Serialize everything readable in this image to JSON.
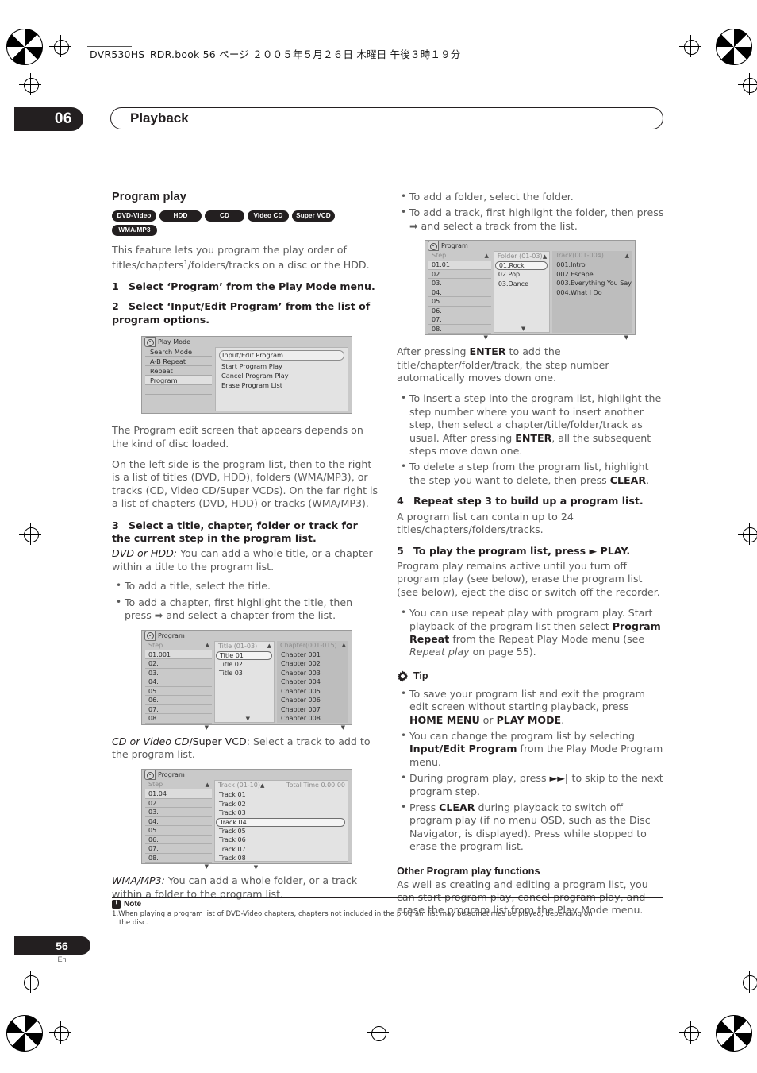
{
  "print_header": "DVR530HS_RDR.book  56 ページ  ２００５年５月２６日   木曜日   午後３時１９分",
  "chapter": {
    "number": "06",
    "title": "Playback"
  },
  "folio": {
    "page": "56",
    "lang": "En"
  },
  "left": {
    "section_title": "Program play",
    "badges": [
      "DVD-Video",
      "HDD",
      "CD",
      "Video CD",
      "Super VCD",
      "WMA/MP3"
    ],
    "intro": "This feature lets you program the play order of titles/chapters",
    "intro_sup": "1",
    "intro_rest": "/folders/tracks on a disc or the HDD.",
    "step1_num": "1",
    "step1": "Select ‘Program’ from the Play Mode menu.",
    "step2_num": "2",
    "step2": "Select ‘Input/Edit Program’ from the list of program options.",
    "play_mode_osd": {
      "title": "Play Mode",
      "menu": [
        "Search Mode",
        "A-B Repeat",
        "Repeat",
        "Program"
      ],
      "selected_menu": "Program",
      "options": [
        "Input/Edit Program",
        "Start Program Play",
        "Cancel Program Play",
        "Erase Program List"
      ],
      "highlighted_option": "Input/Edit Program"
    },
    "para_depends": "The Program edit screen that appears depends on the kind of disc loaded.",
    "para_layout": "On the left side is the program list, then to the right is a list of titles (DVD, HDD), folders (WMA/MP3), or tracks (CD, Video CD/Super VCDs). On the far right is a list of chapters (DVD, HDD) or tracks (WMA/MP3).",
    "step3_num": "3",
    "step3": "Select a title, chapter, folder or track for the current step in the program list.",
    "dvd_hdd_label": "DVD or HDD:",
    "dvd_hdd_text": " You can add a whole title, or a chapter within a title to the program list.",
    "bullets_dvd": [
      "To add a title, select the title.",
      "To add a chapter, first highlight the title, then press ➡ and select a chapter from the list."
    ],
    "program_osd_dvd": {
      "title": "Program",
      "col1_head": "Step",
      "col2_head": "Title (01-03)",
      "col3_head": "Chapter(001-015)",
      "steps": [
        "01.001",
        "02.",
        "03.",
        "04.",
        "05.",
        "06.",
        "07.",
        "08."
      ],
      "titles": [
        "Title 01",
        "Title 02",
        "Title 03"
      ],
      "highlighted_title": "Title 01",
      "chapters": [
        "Chapter 001",
        "Chapter 002",
        "Chapter 003",
        "Chapter 004",
        "Chapter 005",
        "Chapter 006",
        "Chapter 007",
        "Chapter 008"
      ]
    },
    "cd_label": "CD or Video CD",
    "cd_label2": "/Super VCD:",
    "cd_text": " Select a track to add to the program list.",
    "program_osd_cd": {
      "title": "Program",
      "col1_head": "Step",
      "col2_head": "Track (01-10)",
      "col3_head": "Total  Time  0.00.00",
      "steps": [
        "01.04",
        "02.",
        "03.",
        "04.",
        "05.",
        "06.",
        "07.",
        "08."
      ],
      "tracks": [
        "Track 01",
        "Track 02",
        "Track 03",
        "Track 04",
        "Track 05",
        "Track 06",
        "Track 07",
        "Track 08"
      ],
      "highlighted_track": "Track 04"
    },
    "wma_label": "WMA/MP3:",
    "wma_text": " You can add a whole folder, or a track within a folder to the program list."
  },
  "right": {
    "bullets_wma": [
      "To add a folder, select the folder.",
      "To add a track, first highlight the folder, then press ➡ and select a track from the list."
    ],
    "program_osd_wma": {
      "title": "Program",
      "col1_head": "Step",
      "col2_head": "Folder (01-03)",
      "col3_head": "Track(001-004)",
      "steps": [
        "01.01",
        "02.",
        "03.",
        "04.",
        "05.",
        "06.",
        "07.",
        "08."
      ],
      "folders": [
        "01.Rock",
        "02.Pop",
        "03.Dance"
      ],
      "highlighted_folder": "01.Rock",
      "tracks": [
        "001.Intro",
        "002.Escape",
        "003.Everything You Say",
        "004.What I Do"
      ]
    },
    "after_enter_a": "After pressing ",
    "after_enter_b": "ENTER",
    "after_enter_c": " to add the title/chapter/folder/track, the step number automatically moves down one.",
    "bullet_insert_a": "To insert a step into the program list, highlight the step number where you want to insert another step, then select a chapter/title/folder/track as usual. After pressing ",
    "bullet_insert_b": "ENTER",
    "bullet_insert_c": ", all the subsequent steps move down one.",
    "bullet_delete_a": "To delete a step from the program list, highlight the step you want to delete, then press ",
    "bullet_delete_b": "CLEAR",
    "bullet_delete_c": ".",
    "step4_num": "4",
    "step4": "Repeat step 3 to build up a program list.",
    "step4_body": "A program list can contain up to 24 titles/chapters/folders/tracks.",
    "step5_num": "5",
    "step5": "To play the program list, press ► PLAY.",
    "step5_body": "Program play remains active until you turn off program play (see below), erase the program list (see below), eject the disc or switch off the recorder.",
    "bullet_repeat_a": "You can use repeat play with program play. Start playback of the program list then select ",
    "bullet_repeat_b": "Program Repeat",
    "bullet_repeat_c": " from the Repeat Play Mode menu (see ",
    "bullet_repeat_d": "Repeat play",
    "bullet_repeat_e": " on page 55).",
    "tip_label": "Tip",
    "tip1_a": "To save your program list and exit the program edit screen without starting playback, press ",
    "tip1_b": "HOME MENU",
    "tip1_c": " or ",
    "tip1_d": "PLAY MODE",
    "tip1_e": ".",
    "tip2_a": "You can change the program list by selecting ",
    "tip2_b": "Input/Edit Program",
    "tip2_c": " from the Play Mode Program menu.",
    "tip3_a": "During program play, press ",
    "tip3_b": "►►|",
    "tip3_c": " to skip to the next program step.",
    "tip4_a": "Press ",
    "tip4_b": "CLEAR",
    "tip4_c": " during playback to switch off program play (if no menu OSD, such as the Disc Navigator, is displayed). Press while stopped to erase the program list.",
    "other_head": "Other Program play functions",
    "other_body": "As well as creating and editing a program list, you can start program play, cancel program play, and erase the program list from the Play Mode menu."
  },
  "note": {
    "label": "Note",
    "text": "1.When playing a program list of DVD-Video chapters, chapters not included in the program list may be sometimes be played, depending on",
    "text2": "the disc."
  }
}
